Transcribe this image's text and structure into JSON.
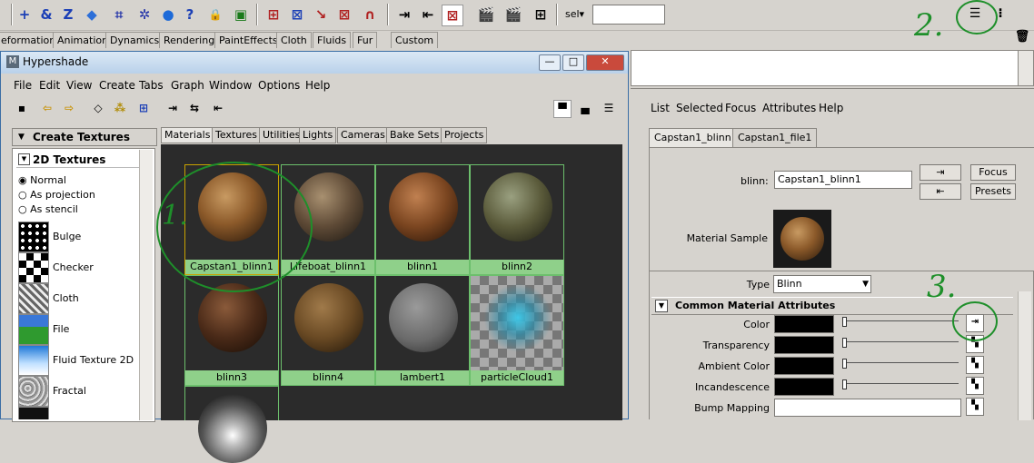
{
  "toolbar": {
    "icons": [
      "+",
      "&",
      "Z",
      "◆",
      "⌗",
      "✲",
      "●",
      "?",
      "🔒",
      "▣",
      "⊞",
      "⊠",
      "↘",
      "⊠",
      "∩",
      "⇥",
      "⇤",
      "⊠",
      "🎬",
      "🎬",
      "⊞"
    ],
    "sel_label": "sel▾",
    "sel_value": ""
  },
  "shelf_tabs": [
    "eformation",
    "Animation",
    "Dynamics",
    "Rendering",
    "PaintEffects",
    "Cloth",
    "Fluids",
    "Fur",
    "Custom"
  ],
  "hypershade": {
    "title": "Hypershade",
    "win_min": "—",
    "win_max": "□",
    "win_close": "✕",
    "menus": [
      "File",
      "Edit",
      "View",
      "Create",
      "Tabs",
      "Graph",
      "Window",
      "Options",
      "Help"
    ],
    "create_header": "Create Textures",
    "section": "2D Textures",
    "radios": [
      "Normal",
      "As projection",
      "As stencil"
    ],
    "selected_radio": "Normal",
    "textures": [
      "Bulge",
      "Checker",
      "Cloth",
      "File",
      "Fluid Texture 2D",
      "Fractal"
    ],
    "tabs": [
      "Materials",
      "Textures",
      "Utilities",
      "Lights",
      "Cameras",
      "Bake Sets",
      "Projects"
    ],
    "active_tab": "Materials",
    "materials": [
      "Capstan1_blinn1",
      "Lifeboat_blinn1",
      "blinn1",
      "blinn2",
      "blinn3",
      "blinn4",
      "lambert1",
      "particleCloud1"
    ]
  },
  "attribute_editor": {
    "menus": [
      "List",
      "Selected",
      "Focus",
      "Attributes",
      "Help"
    ],
    "tabs": [
      "Capstan1_blinn1",
      "Capstan1_file1"
    ],
    "name_label": "blinn:",
    "name_value": "Capstan1_blinn1",
    "focus_button": "Focus",
    "presets_button": "Presets",
    "material_sample_label": "Material Sample",
    "type_label": "Type",
    "type_value": "Blinn",
    "section_title": "Common Material Attributes",
    "attributes": [
      "Color",
      "Transparency",
      "Ambient Color",
      "Incandescence",
      "Bump Mapping"
    ]
  },
  "annotations": [
    "1.",
    "2.",
    "3."
  ],
  "colors": {
    "annotation": "#1e8f2a",
    "label_green": "#8fd08a",
    "swatch_border": "#6cbf6c"
  }
}
